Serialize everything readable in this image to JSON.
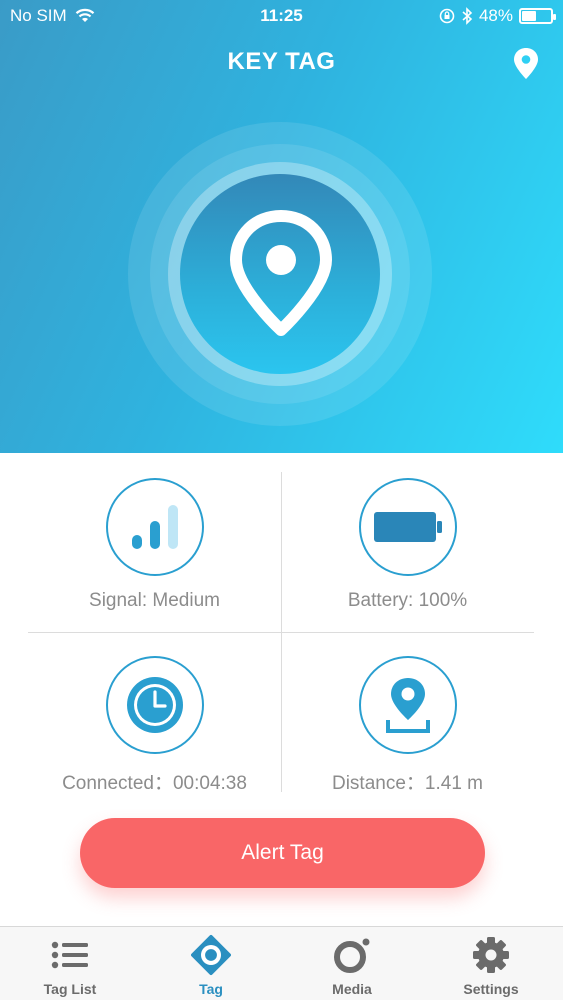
{
  "status_bar": {
    "carrier": "No SIM",
    "time": "11:25",
    "battery_percent": "48%",
    "battery_level": 0.48,
    "icons": [
      "wifi-icon",
      "orientation-lock-icon",
      "bluetooth-icon",
      "battery-icon"
    ]
  },
  "header": {
    "title": "KEY TAG",
    "location_icon": "location-pin-icon"
  },
  "center_icon": "location-pin-icon",
  "stats": {
    "signal": {
      "label": "Signal: Medium",
      "icon": "signal-bars-icon"
    },
    "battery": {
      "label": "Battery: 100%",
      "icon": "battery-full-icon"
    },
    "connected": {
      "label": "Connected：00:04:38",
      "icon": "clock-icon"
    },
    "distance": {
      "label": "Distance：1.41 m",
      "icon": "map-pin-icon"
    }
  },
  "alert_button": {
    "label": "Alert Tag"
  },
  "tabs": [
    {
      "label": "Tag List",
      "icon": "list-icon",
      "active": false
    },
    {
      "label": "Tag",
      "icon": "eye-target-icon",
      "active": true
    },
    {
      "label": "Media",
      "icon": "camera-ring-icon",
      "active": false
    },
    {
      "label": "Settings",
      "icon": "gear-icon",
      "active": false
    }
  ],
  "colors": {
    "accent": "#2a9fd0",
    "alert": "#f96667",
    "gradient_start": "#3a9bc7",
    "gradient_end": "#2fdcfb"
  }
}
